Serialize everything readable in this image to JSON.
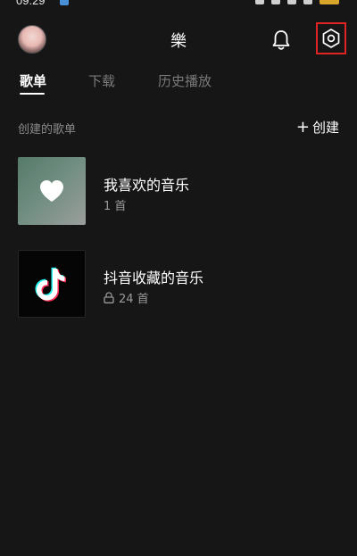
{
  "status_bar": {
    "time": "09:29"
  },
  "header": {
    "title": "樂",
    "avatar_icon": "user-avatar",
    "bell_icon": "bell-icon",
    "settings_icon": "settings-hexagon-icon",
    "highlight_color": "#e02323"
  },
  "tabs": [
    {
      "label": "歌单",
      "active": true
    },
    {
      "label": "下载",
      "active": false
    },
    {
      "label": "历史播放",
      "active": false
    }
  ],
  "section": {
    "title": "创建的歌单",
    "create_label": "创建",
    "create_icon": "plus-icon"
  },
  "playlists": [
    {
      "title": "我喜欢的音乐",
      "count": "1 首",
      "cover_icon": "heart-icon",
      "locked": false
    },
    {
      "title": "抖音收藏的音乐",
      "count": "24 首",
      "cover_icon": "douyin-logo-icon",
      "locked": true
    }
  ],
  "colors": {
    "background": "#161616",
    "text_primary": "#ffffff",
    "text_secondary": "#8a8a8a"
  }
}
